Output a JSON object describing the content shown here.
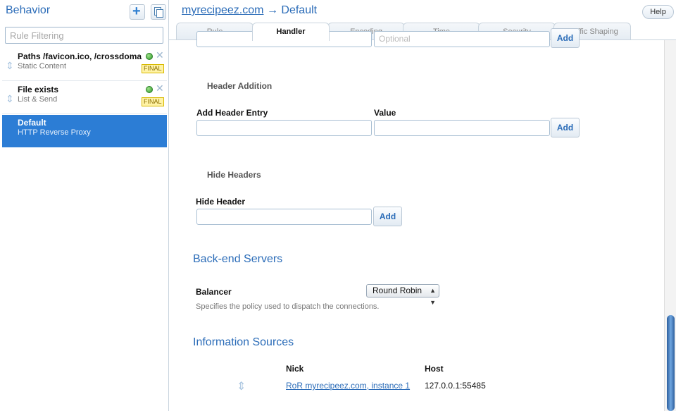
{
  "sidebar": {
    "title": "Behavior",
    "filter_placeholder": "Rule Filtering",
    "rules": [
      {
        "name": "Paths /favicon.ico, /crossdoma",
        "type": "Static Content",
        "badge": "FINAL",
        "status": "active"
      },
      {
        "name": "File exists",
        "type": "List & Send",
        "badge": "FINAL",
        "status": "active"
      },
      {
        "name": "Default",
        "type": "HTTP Reverse Proxy",
        "selected": true
      }
    ]
  },
  "header": {
    "vserver": "myrecipeez.com",
    "arrow": "→",
    "rule": "Default",
    "help_label": "Help"
  },
  "tabs": [
    "Rule",
    "Handler",
    "Encoding",
    "Time",
    "Security",
    "Traffic Shaping"
  ],
  "active_tab": "Handler",
  "partial_row": {
    "value_placeholder": "Optional",
    "add_label": "Add"
  },
  "header_addition": {
    "title": "Header Addition",
    "entry_label": "Add Header Entry",
    "value_label": "Value",
    "add_label": "Add"
  },
  "hide_headers": {
    "title": "Hide Headers",
    "field_label": "Hide Header",
    "add_label": "Add"
  },
  "backend": {
    "title": "Back-end Servers",
    "balancer_label": "Balancer",
    "balancer_value": "Round Robin",
    "balancer_hint": "Specifies the policy used to dispatch the connections."
  },
  "info_sources": {
    "title": "Information Sources",
    "columns": [
      "Nick",
      "Host"
    ],
    "rows": [
      {
        "nick": "RoR myrecipeez.com, instance 1",
        "host": "127.0.0.1:55485"
      }
    ]
  },
  "colors": {
    "accent": "#2b6cb8",
    "selected_row": "#2c7dd5",
    "badge": "#fff3a6"
  }
}
